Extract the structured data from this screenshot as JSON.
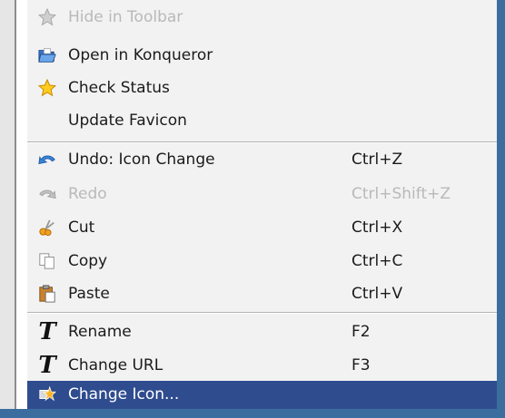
{
  "menu": {
    "items": [
      {
        "label": "Hide in Toolbar",
        "shortcut": "",
        "icon": "star-gray-icon",
        "disabled": true
      },
      {
        "label": "Open in Konqueror",
        "shortcut": "",
        "icon": "folder-open-icon"
      },
      {
        "label": "Check Status",
        "shortcut": "",
        "icon": "star-icon"
      },
      {
        "label": "Update Favicon",
        "shortcut": "",
        "icon": ""
      },
      {
        "label": "Undo: Icon Change",
        "shortcut": "Ctrl+Z",
        "icon": "undo-icon"
      },
      {
        "label": "Redo",
        "shortcut": "Ctrl+Shift+Z",
        "icon": "redo-icon",
        "disabled": true
      },
      {
        "label": "Cut",
        "shortcut": "Ctrl+X",
        "icon": "scissors-icon"
      },
      {
        "label": "Copy",
        "shortcut": "Ctrl+C",
        "icon": "copy-icon"
      },
      {
        "label": "Paste",
        "shortcut": "Ctrl+V",
        "icon": "paste-icon"
      },
      {
        "label": "Rename",
        "shortcut": "F2",
        "icon": "text-t-icon"
      },
      {
        "label": "Change URL",
        "shortcut": "F3",
        "icon": "text-t-icon"
      },
      {
        "label": "Change Icon...",
        "shortcut": "",
        "icon": "change-icon-icon",
        "highlighted": true
      }
    ]
  },
  "colors": {
    "menu_background": "#f2f2f2",
    "highlight": "#2f4c8f",
    "disabled_text": "#b9b9b9",
    "window_frame": "#3b6e9e"
  }
}
